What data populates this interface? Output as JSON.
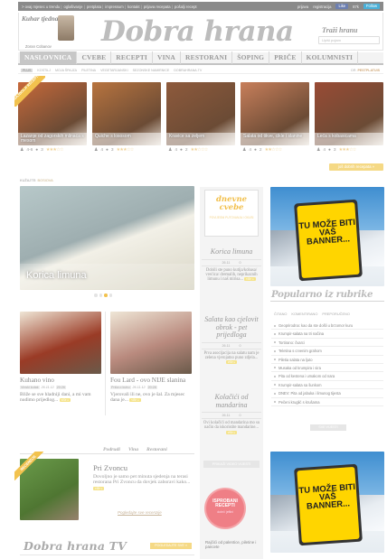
{
  "topbar": {
    "links": [
      "> ovaj mjesec u trendu",
      "oglašivanje",
      "pretplata",
      "impressum",
      "kontakt",
      "prijava recepata",
      "pošalji recept"
    ],
    "login": "prijava",
    "register": "registracija",
    "like": "Like",
    "like_count": "87k",
    "follow": "Follow"
  },
  "header": {
    "chef_title": "Kuhar tjedna",
    "chef_name": "Zoran Cobanov",
    "logo": "Dobra hrana",
    "search_label": "Traži hranu",
    "search_placeholder": "Upiši pojam"
  },
  "nav": [
    "NASLOVNICA",
    "CVEBE",
    "RECEPTI",
    "VINA",
    "RESTORANI",
    "ŠOPING",
    "PRIČE",
    "KOLUMNISTI"
  ],
  "subnav": {
    "plus": "PLUS",
    "items": [
      "KOSTILJ",
      "MOJA ŠPAJZA",
      "PILETINA",
      "VEGETARIJANSKI",
      "SEZONSKE NAMIRNICE",
      "DOBRAHRANA.TV"
    ],
    "dr_label": "DR.",
    "dr_value": "PESTPLATUIS"
  },
  "featured_badge": "NAJBOLJI RECEPTI",
  "recipes": [
    {
      "title": "Lazanje od zagorskih mlinaca s mesom",
      "people": "4-6",
      "level": "3",
      "stars": "★★★☆☆",
      "color": "#c7693a"
    },
    {
      "title": "Quiche s lososom",
      "people": "4",
      "level": "3",
      "stars": "★★★☆☆",
      "color": "#b8743f"
    },
    {
      "title": "Kravice sa zeljem",
      "people": "4",
      "level": "2",
      "stars": "★★☆☆☆",
      "color": "#8e5a3c"
    },
    {
      "title": "Salata od tikve, cikle i slanine",
      "people": "4",
      "level": "2",
      "stars": "★★☆☆☆",
      "color": "#c87f5b"
    },
    {
      "title": "Leća s kobasicama",
      "people": "4",
      "level": "3",
      "stars": "★★★☆☆",
      "color": "#994b35"
    }
  ],
  "more_recipes": "još dobrih recepata »",
  "breadcrumb": {
    "label": "KUŽAJTE:",
    "value": "BOSIOVA"
  },
  "slider": {
    "caption": "Korica limuna"
  },
  "articles": [
    {
      "title": "Kuhano vino",
      "tag": "Vinski kutak",
      "date": "26.11.12",
      "time": "20:26",
      "excerpt": "Bliže se sve hladniji dani, a mi vam nudimo prijedlog...",
      "more": "više »",
      "color": "#9a3b26"
    },
    {
      "title": "Fou Lard - ovo NIJE slanina",
      "tag": "Priča o kuhu",
      "date": "26.11.12",
      "time": "20:28",
      "excerpt": "Vjerovali ili ne, ovo je šal. Za mjesec dana je...",
      "more": "više »",
      "color": "#b98a7e"
    }
  ],
  "reviews": {
    "tabs": [
      "Podrudi",
      "Vina",
      "Restorani"
    ],
    "badge": "RECENZIJE",
    "title": "Pri Zvoncu",
    "text": "Dovoljno je samo pet minuta sjedenja na terasi restorana Pri Zvoncu da dovjek zaboravi kako...",
    "more": "više »",
    "link": "Pogledajte sve recenzije"
  },
  "tv": {
    "title": "Dobra hrana TV",
    "button": "POGLEDAJTE SVE »"
  },
  "cafe": {
    "title": "dnevne cvebe",
    "subtitle": "POVIJESNI PUTOVANJA I OKUSI"
  },
  "mid_cards": [
    {
      "title": "Korica limuna",
      "date": "26.11",
      "comments": "0",
      "excerpt": "Dobili ste puno kutija/kobasa/ vrećica/ dremalih, neprikaznih limunu i naš mirisa...",
      "more": "više »"
    },
    {
      "title": "Salata kao cjelovit obrok - pet prijedloga",
      "date": "26.11",
      "comments": "0",
      "excerpt": "Prva asocijacija na salatu nam je zelena vjerojatno puno zdjela...",
      "more": "više »"
    },
    {
      "title": "Kolačići od mandarina",
      "date": "26.11",
      "comments": "0",
      "excerpt": "Ovi kolačići od mandarina mo su način da iskoristite mandarine...",
      "more": "više »"
    }
  ],
  "video_button": "PRIKAŽI VIDEO VIJESTI",
  "bad_badge": {
    "title": "ISPROBANI RECEPTI",
    "sub": "dobri i jeftini"
  },
  "mid_bullet": "Rajčići od palentice, piletine i pancete",
  "banner": {
    "text": "TU MOŽE BITI VAŠ BANNER..."
  },
  "popular": {
    "title": "Popularno iz rubrike",
    "tabs": [
      "ČITANO",
      "KOMENTIRANO",
      "PREPORUČENO"
    ],
    "items": [
      "Geoprirodna: kao da ste došli u brzomor kuru",
      "Krumpir-salata na tri načina",
      "Tortirano: čvarci",
      "Teletina s crvenim grahom",
      "Piletia salata na ljuto",
      "Musaka od krumpira i sira",
      "Pita od kestena i umakom od nara",
      "Krumpir-salata sa šunkom",
      "DNEV: Pita od jabuka i limunog tijesta",
      "Pečeni kruglić s krušama"
    ],
    "more": "SVE VIJESTI"
  }
}
